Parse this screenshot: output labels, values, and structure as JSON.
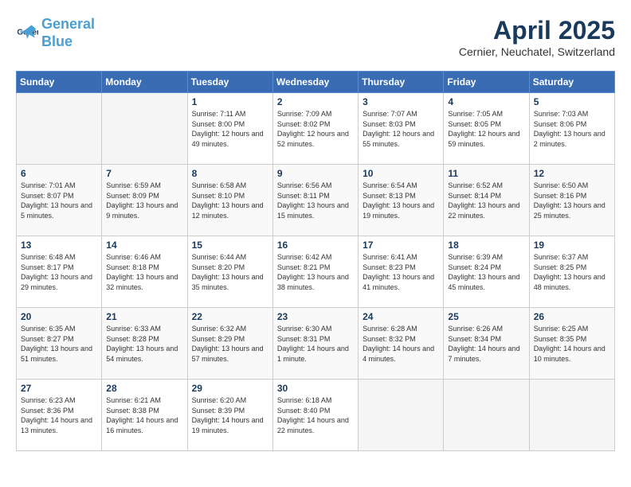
{
  "header": {
    "logo_line1": "General",
    "logo_line2": "Blue",
    "month": "April 2025",
    "location": "Cernier, Neuchatel, Switzerland"
  },
  "days_of_week": [
    "Sunday",
    "Monday",
    "Tuesday",
    "Wednesday",
    "Thursday",
    "Friday",
    "Saturday"
  ],
  "weeks": [
    [
      {
        "day": "",
        "info": ""
      },
      {
        "day": "",
        "info": ""
      },
      {
        "day": "1",
        "info": "Sunrise: 7:11 AM\nSunset: 8:00 PM\nDaylight: 12 hours and 49 minutes."
      },
      {
        "day": "2",
        "info": "Sunrise: 7:09 AM\nSunset: 8:02 PM\nDaylight: 12 hours and 52 minutes."
      },
      {
        "day": "3",
        "info": "Sunrise: 7:07 AM\nSunset: 8:03 PM\nDaylight: 12 hours and 55 minutes."
      },
      {
        "day": "4",
        "info": "Sunrise: 7:05 AM\nSunset: 8:05 PM\nDaylight: 12 hours and 59 minutes."
      },
      {
        "day": "5",
        "info": "Sunrise: 7:03 AM\nSunset: 8:06 PM\nDaylight: 13 hours and 2 minutes."
      }
    ],
    [
      {
        "day": "6",
        "info": "Sunrise: 7:01 AM\nSunset: 8:07 PM\nDaylight: 13 hours and 5 minutes."
      },
      {
        "day": "7",
        "info": "Sunrise: 6:59 AM\nSunset: 8:09 PM\nDaylight: 13 hours and 9 minutes."
      },
      {
        "day": "8",
        "info": "Sunrise: 6:58 AM\nSunset: 8:10 PM\nDaylight: 13 hours and 12 minutes."
      },
      {
        "day": "9",
        "info": "Sunrise: 6:56 AM\nSunset: 8:11 PM\nDaylight: 13 hours and 15 minutes."
      },
      {
        "day": "10",
        "info": "Sunrise: 6:54 AM\nSunset: 8:13 PM\nDaylight: 13 hours and 19 minutes."
      },
      {
        "day": "11",
        "info": "Sunrise: 6:52 AM\nSunset: 8:14 PM\nDaylight: 13 hours and 22 minutes."
      },
      {
        "day": "12",
        "info": "Sunrise: 6:50 AM\nSunset: 8:16 PM\nDaylight: 13 hours and 25 minutes."
      }
    ],
    [
      {
        "day": "13",
        "info": "Sunrise: 6:48 AM\nSunset: 8:17 PM\nDaylight: 13 hours and 29 minutes."
      },
      {
        "day": "14",
        "info": "Sunrise: 6:46 AM\nSunset: 8:18 PM\nDaylight: 13 hours and 32 minutes."
      },
      {
        "day": "15",
        "info": "Sunrise: 6:44 AM\nSunset: 8:20 PM\nDaylight: 13 hours and 35 minutes."
      },
      {
        "day": "16",
        "info": "Sunrise: 6:42 AM\nSunset: 8:21 PM\nDaylight: 13 hours and 38 minutes."
      },
      {
        "day": "17",
        "info": "Sunrise: 6:41 AM\nSunset: 8:23 PM\nDaylight: 13 hours and 41 minutes."
      },
      {
        "day": "18",
        "info": "Sunrise: 6:39 AM\nSunset: 8:24 PM\nDaylight: 13 hours and 45 minutes."
      },
      {
        "day": "19",
        "info": "Sunrise: 6:37 AM\nSunset: 8:25 PM\nDaylight: 13 hours and 48 minutes."
      }
    ],
    [
      {
        "day": "20",
        "info": "Sunrise: 6:35 AM\nSunset: 8:27 PM\nDaylight: 13 hours and 51 minutes."
      },
      {
        "day": "21",
        "info": "Sunrise: 6:33 AM\nSunset: 8:28 PM\nDaylight: 13 hours and 54 minutes."
      },
      {
        "day": "22",
        "info": "Sunrise: 6:32 AM\nSunset: 8:29 PM\nDaylight: 13 hours and 57 minutes."
      },
      {
        "day": "23",
        "info": "Sunrise: 6:30 AM\nSunset: 8:31 PM\nDaylight: 14 hours and 1 minute."
      },
      {
        "day": "24",
        "info": "Sunrise: 6:28 AM\nSunset: 8:32 PM\nDaylight: 14 hours and 4 minutes."
      },
      {
        "day": "25",
        "info": "Sunrise: 6:26 AM\nSunset: 8:34 PM\nDaylight: 14 hours and 7 minutes."
      },
      {
        "day": "26",
        "info": "Sunrise: 6:25 AM\nSunset: 8:35 PM\nDaylight: 14 hours and 10 minutes."
      }
    ],
    [
      {
        "day": "27",
        "info": "Sunrise: 6:23 AM\nSunset: 8:36 PM\nDaylight: 14 hours and 13 minutes."
      },
      {
        "day": "28",
        "info": "Sunrise: 6:21 AM\nSunset: 8:38 PM\nDaylight: 14 hours and 16 minutes."
      },
      {
        "day": "29",
        "info": "Sunrise: 6:20 AM\nSunset: 8:39 PM\nDaylight: 14 hours and 19 minutes."
      },
      {
        "day": "30",
        "info": "Sunrise: 6:18 AM\nSunset: 8:40 PM\nDaylight: 14 hours and 22 minutes."
      },
      {
        "day": "",
        "info": ""
      },
      {
        "day": "",
        "info": ""
      },
      {
        "day": "",
        "info": ""
      }
    ]
  ]
}
